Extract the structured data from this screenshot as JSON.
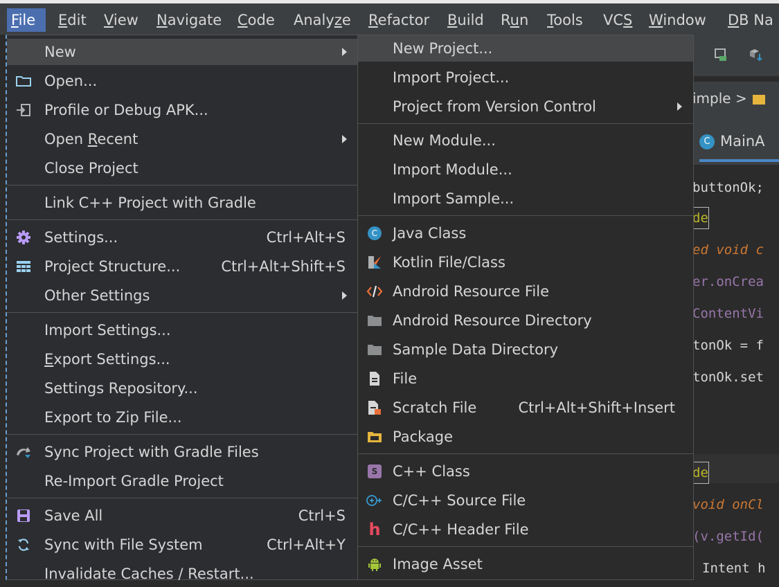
{
  "menubar": [
    {
      "pre": "",
      "u": "F",
      "post": "ile",
      "active": true
    },
    {
      "pre": "",
      "u": "E",
      "post": "dit"
    },
    {
      "pre": "",
      "u": "V",
      "post": "iew"
    },
    {
      "pre": "",
      "u": "N",
      "post": "avigate"
    },
    {
      "pre": "",
      "u": "C",
      "post": "ode"
    },
    {
      "pre": "Analy",
      "u": "z",
      "post": "e"
    },
    {
      "pre": "",
      "u": "R",
      "post": "efactor"
    },
    {
      "pre": "",
      "u": "B",
      "post": "uild"
    },
    {
      "pre": "R",
      "u": "u",
      "post": "n"
    },
    {
      "pre": "",
      "u": "T",
      "post": "ools"
    },
    {
      "pre": "VC",
      "u": "S",
      "post": ""
    },
    {
      "pre": "",
      "u": "W",
      "post": "indow"
    },
    {
      "pre": "",
      "u": "D",
      "post": "B Na"
    }
  ],
  "file_menu": {
    "new": "New",
    "open": "Open...",
    "profile_apk": "Profile or Debug APK...",
    "open_recent": {
      "pre": "Open ",
      "u": "R",
      "post": "ecent"
    },
    "close_project": "Close Project",
    "link_cpp": "Link C++ Project with Gradle",
    "settings": "Settings...",
    "settings_sc": "Ctrl+Alt+S",
    "project_structure": "Project Structure...",
    "project_structure_sc": "Ctrl+Alt+Shift+S",
    "other_settings": "Other Settings",
    "import_settings": "Import Settings...",
    "export_settings": {
      "pre": "",
      "u": "E",
      "post": "xport Settings..."
    },
    "settings_repo": "Settings Repository...",
    "export_zip": "Export to Zip File...",
    "sync_gradle": "Sync Project with Gradle Files",
    "reimport_gradle": "Re-Import Gradle Project",
    "save_all": "Save All",
    "save_all_sc": "Ctrl+S",
    "sync_fs": "Sync with File System",
    "sync_fs_sc": "Ctrl+Alt+Y",
    "invalidate": "Invalidate Caches / Restart..."
  },
  "new_menu": {
    "new_project": "New Project...",
    "import_project": "Import Project...",
    "project_vcs": "Project from Version Control",
    "new_module": "New Module...",
    "import_module": "Import Module...",
    "import_sample": "Import Sample...",
    "java_class": "Java Class",
    "kotlin_file": "Kotlin File/Class",
    "android_resource_file": "Android Resource File",
    "android_resource_dir": "Android Resource Directory",
    "sample_data_dir": "Sample Data Directory",
    "file": "File",
    "scratch_file": "Scratch File",
    "scratch_sc": "Ctrl+Alt+Shift+Insert",
    "package": "Package",
    "cpp_class": "C++ Class",
    "cpp_source": "C/C++ Source File",
    "cpp_header": "C/C++ Header File",
    "image_asset": "Image Asset"
  },
  "ide": {
    "breadcrumb": "imple > ",
    "tab": "MainA",
    "code": [
      "buttonOk;",
      "de",
      "ed void c",
      "er.onCrea",
      "ContentVi",
      "tonOk = f",
      "tonOk.set",
      "de",
      "void onCl",
      "(v.getId(",
      "Intent h"
    ]
  }
}
